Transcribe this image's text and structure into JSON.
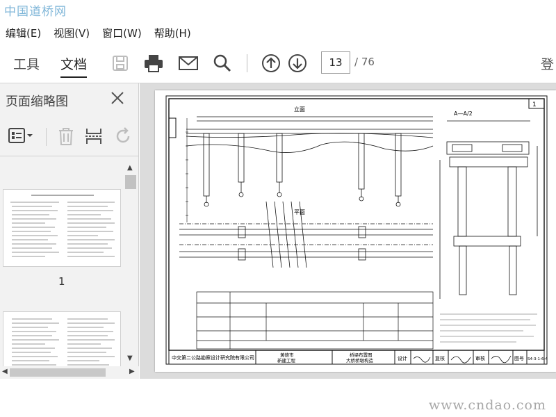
{
  "watermarks": {
    "top": "中国道桥网",
    "bottom": "www.cndao.com"
  },
  "menu": {
    "edit": "编辑(E)",
    "view": "视图(V)",
    "window": "窗口(W)",
    "help": "帮助(H)"
  },
  "toolbar": {
    "tab_tools": "工具",
    "tab_document": "文档",
    "current_page": "13",
    "total_pages": "/ 76",
    "login": "登"
  },
  "sidebar": {
    "title": "页面缩略图",
    "thumb1_label": "1"
  },
  "drawing": {
    "section_label": "A—A/2",
    "page_ref": "1",
    "company": "中交第二公路勘察设计研究院有限公司",
    "project_line1": "黄德市",
    "project_line2": "新建工程",
    "drawing_title_line1": "桥梁布置图",
    "drawing_title_line2": "大桥桥墩构造",
    "design": "设计",
    "review": "复核",
    "approve": "审核",
    "drawing_no_label": "图号",
    "drawing_no": "S4-3-1-6-4",
    "plan_label": "平面",
    "elevation_label": "立面"
  },
  "colors": {
    "accent": "#222222",
    "sidebar_bg": "#f2f2f2",
    "viewer_bg": "#dcdcdc"
  }
}
